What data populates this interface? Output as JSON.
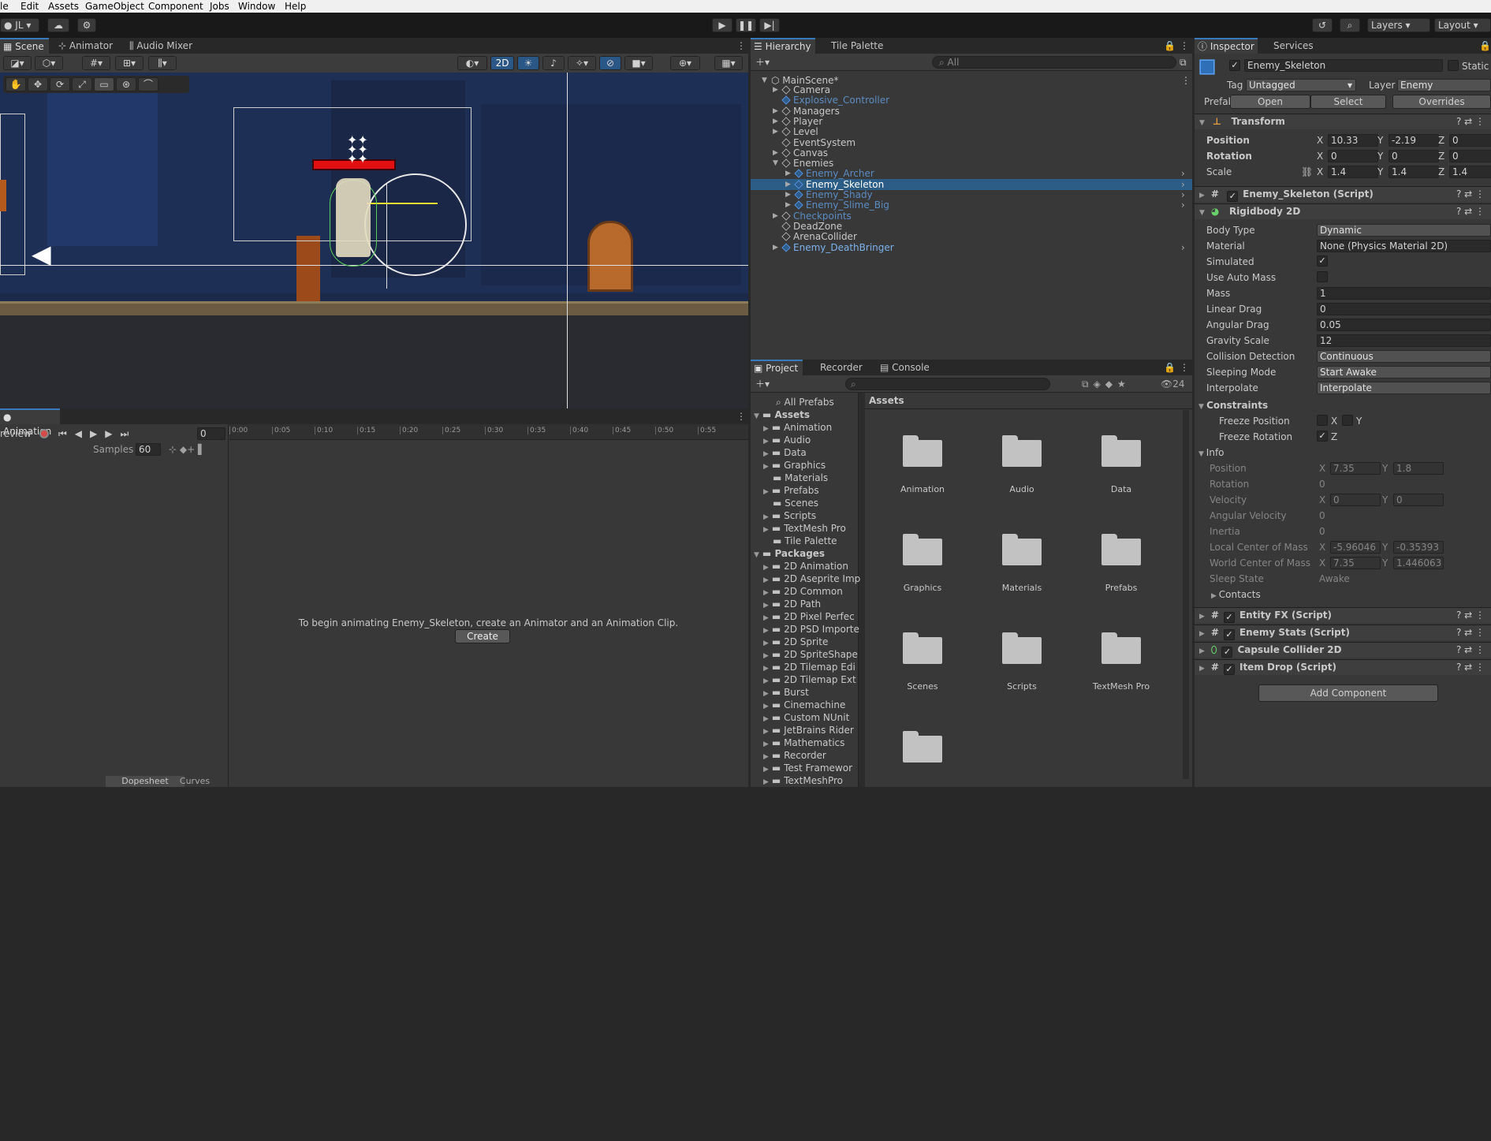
{
  "menu": [
    "le",
    "Edit",
    "Assets",
    "GameObject",
    "Component",
    "Jobs",
    "Window",
    "Help"
  ],
  "toolbar": {
    "account": "JL",
    "layers": "Layers",
    "layout": "Layout"
  },
  "scene_tabs": [
    "Scene",
    "Animator",
    "Audio Mixer"
  ],
  "scene_toolbar": {
    "mode_2d": "2D"
  },
  "hierarchy": {
    "tabs": [
      "Hierarchy",
      "Tile Palette"
    ],
    "search_placeholder": "All",
    "scene": "MainScene*",
    "items": [
      {
        "label": "Camera",
        "indent": 1,
        "prefab": false,
        "arrow": true,
        "dim": false
      },
      {
        "label": "Explosive_Controller",
        "indent": 1,
        "prefab": true,
        "arrow": false,
        "dim": true
      },
      {
        "label": "Managers",
        "indent": 1,
        "prefab": false,
        "arrow": true,
        "dim": false
      },
      {
        "label": "Player",
        "indent": 1,
        "prefab": false,
        "arrow": true,
        "dim": false
      },
      {
        "label": "Level",
        "indent": 1,
        "prefab": false,
        "arrow": true,
        "dim": false
      },
      {
        "label": "EventSystem",
        "indent": 1,
        "prefab": false,
        "arrow": false,
        "dim": false
      },
      {
        "label": "Canvas",
        "indent": 1,
        "prefab": false,
        "arrow": true,
        "dim": false
      },
      {
        "label": "Enemies",
        "indent": 1,
        "prefab": false,
        "arrow": true,
        "dim": false,
        "open": true
      },
      {
        "label": "Enemy_Archer",
        "indent": 2,
        "prefab": true,
        "arrow": true,
        "dim": true
      },
      {
        "label": "Enemy_Skeleton",
        "indent": 2,
        "prefab": true,
        "arrow": true,
        "dim": false,
        "selected": true
      },
      {
        "label": "Enemy_Shady",
        "indent": 2,
        "prefab": true,
        "arrow": true,
        "dim": true
      },
      {
        "label": "Enemy_Slime_Big",
        "indent": 2,
        "prefab": true,
        "arrow": true,
        "dim": true
      },
      {
        "label": "Checkpoints",
        "indent": 1,
        "prefab": false,
        "arrow": true,
        "dim": true
      },
      {
        "label": "DeadZone",
        "indent": 1,
        "prefab": false,
        "arrow": false,
        "dim": false
      },
      {
        "label": "ArenaCollider",
        "indent": 1,
        "prefab": false,
        "arrow": false,
        "dim": false
      },
      {
        "label": "Enemy_DeathBringer",
        "indent": 1,
        "prefab": true,
        "arrow": true,
        "dim": false,
        "blue": true
      }
    ]
  },
  "project": {
    "tabs": [
      "Project",
      "Recorder",
      "Console"
    ],
    "count": "24",
    "all_prefabs": "All Prefabs",
    "assets_header": "Assets",
    "tree": [
      {
        "label": "Assets",
        "root": true
      },
      {
        "label": "Animation"
      },
      {
        "label": "Audio"
      },
      {
        "label": "Data"
      },
      {
        "label": "Graphics"
      },
      {
        "label": "Materials",
        "noarrow": true
      },
      {
        "label": "Prefabs"
      },
      {
        "label": "Scenes",
        "noarrow": true
      },
      {
        "label": "Scripts"
      },
      {
        "label": "TextMesh Pro"
      },
      {
        "label": "Tile Palette",
        "noarrow": true
      },
      {
        "label": "Packages",
        "root": true
      },
      {
        "label": "2D Animation"
      },
      {
        "label": "2D Aseprite Imp"
      },
      {
        "label": "2D Common"
      },
      {
        "label": "2D Path"
      },
      {
        "label": "2D Pixel Perfec"
      },
      {
        "label": "2D PSD Importe"
      },
      {
        "label": "2D Sprite"
      },
      {
        "label": "2D SpriteShape"
      },
      {
        "label": "2D Tilemap Edi"
      },
      {
        "label": "2D Tilemap Ext"
      },
      {
        "label": "Burst"
      },
      {
        "label": "Cinemachine"
      },
      {
        "label": "Custom NUnit"
      },
      {
        "label": "JetBrains Rider"
      },
      {
        "label": "Mathematics"
      },
      {
        "label": "Recorder"
      },
      {
        "label": "Test Framewor"
      },
      {
        "label": "TextMeshPro"
      }
    ],
    "folders": [
      "Animation",
      "Audio",
      "Data",
      "Graphics",
      "Materials",
      "Prefabs",
      "Scenes",
      "Scripts",
      "TextMesh Pro",
      ""
    ]
  },
  "animation": {
    "tab": "Animation",
    "preview": "review",
    "frame": "0",
    "samples_label": "Samples",
    "samples": "60",
    "ruler": [
      "0:00",
      "0:05",
      "0:10",
      "0:15",
      "0:20",
      "0:25",
      "0:30",
      "0:35",
      "0:40",
      "0:45",
      "0:50",
      "0:55"
    ],
    "message": "To begin animating Enemy_Skeleton, create an Animator and an Animation Clip.",
    "create": "Create",
    "bottom_tabs": [
      "Dopesheet",
      "Curves"
    ]
  },
  "inspector": {
    "tabs": [
      "Inspector",
      "Services"
    ],
    "name": "Enemy_Skeleton",
    "static": "Static",
    "tag_label": "Tag",
    "tag": "Untagged",
    "layer_label": "Layer",
    "layer": "Enemy",
    "prefab_label": "Prefab",
    "open": "Open",
    "select": "Select",
    "overrides": "Overrides",
    "transform": {
      "title": "Transform",
      "position_label": "Position",
      "position": [
        "10.33",
        "-2.19",
        "0"
      ],
      "rotation_label": "Rotation",
      "rotation": [
        "0",
        "0",
        "0"
      ],
      "scale_label": "Scale",
      "scale": [
        "1.4",
        "1.4",
        "1.4"
      ]
    },
    "script_title": "Enemy_Skeleton (Script)",
    "rb": {
      "title": "Rigidbody 2D",
      "rows": [
        {
          "label": "Body Type",
          "value": "Dynamic",
          "kind": "dd"
        },
        {
          "label": "Material",
          "value": "None (Physics Material 2D)",
          "kind": "field"
        },
        {
          "label": "Simulated",
          "value": "✓",
          "kind": "chk"
        },
        {
          "label": "Use Auto Mass",
          "value": "",
          "kind": "chk"
        },
        {
          "label": "Mass",
          "value": "1",
          "kind": "field"
        },
        {
          "label": "Linear Drag",
          "value": "0",
          "kind": "field"
        },
        {
          "label": "Angular Drag",
          "value": "0.05",
          "kind": "field"
        },
        {
          "label": "Gravity Scale",
          "value": "12",
          "kind": "field"
        },
        {
          "label": "Collision Detection",
          "value": "Continuous",
          "kind": "dd"
        },
        {
          "label": "Sleeping Mode",
          "value": "Start Awake",
          "kind": "dd"
        },
        {
          "label": "Interpolate",
          "value": "Interpolate",
          "kind": "dd"
        }
      ],
      "constraints": "Constraints",
      "freeze_pos": "Freeze Position",
      "freeze_rot": "Freeze Rotation",
      "info": "Info",
      "info_rows": [
        {
          "label": "Position",
          "x": "7.35",
          "y": "1.8"
        },
        {
          "label": "Rotation",
          "v": "0"
        },
        {
          "label": "Velocity",
          "x": "0",
          "y": "0"
        },
        {
          "label": "Angular Velocity",
          "v": "0"
        },
        {
          "label": "Inertia",
          "v": "0"
        },
        {
          "label": "Local Center of Mass",
          "x": "-5.96046",
          "y": "-0.35393"
        },
        {
          "label": "World Center of Mass",
          "x": "7.35",
          "y": "1.446063"
        },
        {
          "label": "Sleep State",
          "v": "Awake"
        }
      ],
      "contacts": "Contacts"
    },
    "components": [
      "Entity FX (Script)",
      "Enemy Stats (Script)",
      "Capsule Collider 2D",
      "Item Drop (Script)"
    ],
    "add_component": "Add Component",
    "x": "X",
    "y": "Y",
    "z": "Z"
  }
}
